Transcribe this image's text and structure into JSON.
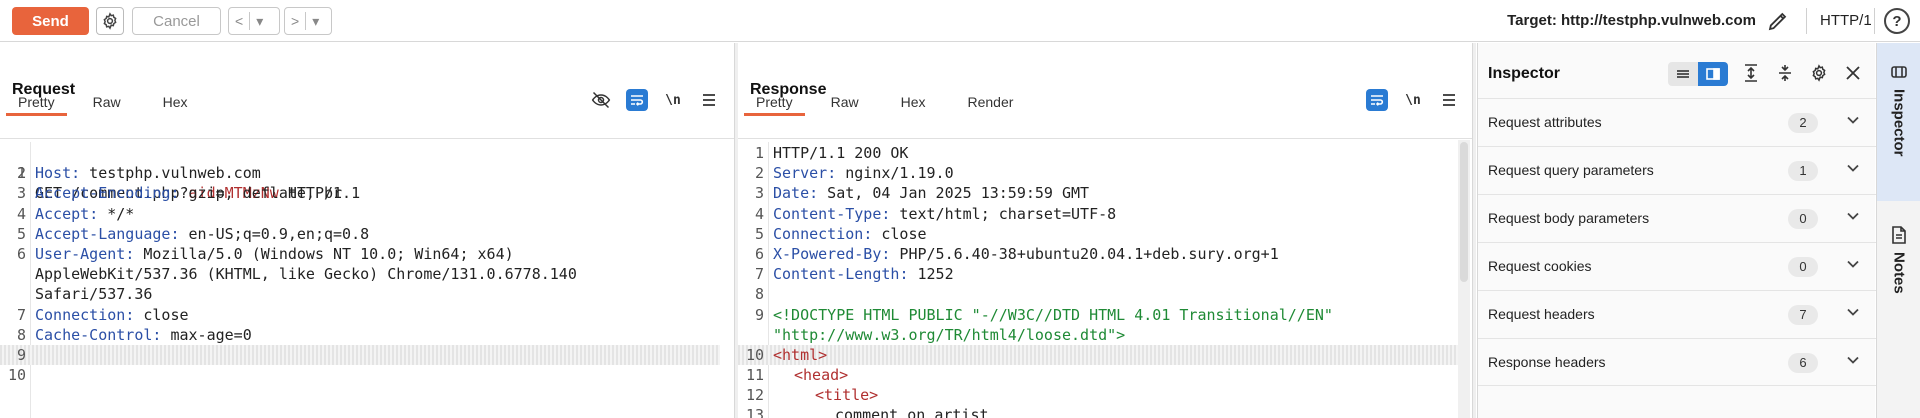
{
  "toolbar": {
    "send_label": "Send",
    "cancel_label": "Cancel",
    "back_label": "<",
    "back_dropdown": "▾",
    "forward_label": ">",
    "forward_dropdown": "▾",
    "target_text": "Target: http://testphp.vulnweb.com",
    "http_version": "HTTP/1",
    "help_label": "?"
  },
  "request": {
    "title": "Request",
    "tabs": [
      "Pretty",
      "Raw",
      "Hex"
    ],
    "active_tab": "Pretty",
    "lines": [
      {
        "n": "1"
      },
      {
        "n": "2",
        "key": "Host",
        "val": " testphp.vulnweb.com"
      },
      {
        "n": "3",
        "key": "Accept-Encoding",
        "val": " gzip, deflate, br"
      },
      {
        "n": "4",
        "key": "Accept",
        "val": " */*"
      },
      {
        "n": "5",
        "key": "Accept-Language",
        "val": " en-US;q=0.9,en;q=0.8"
      },
      {
        "n": "6",
        "key": "User-Agent",
        "val": " Mozilla/5.0 (Windows NT 10.0; Win64; x64)"
      },
      {
        "n": "",
        "val": "AppleWebKit/537.36 (KHTML, like Gecko) Chrome/131.0.6778.140"
      },
      {
        "n": "",
        "val": "Safari/537.36"
      },
      {
        "n": "7",
        "key": "Connection",
        "val": " close"
      },
      {
        "n": "8",
        "key": "Cache-Control",
        "val": " max-age=0"
      },
      {
        "n": "9"
      },
      {
        "n": "10"
      }
    ],
    "line1": {
      "method": "GET /comment.php?",
      "param_key": "aid",
      "eq": "=",
      "param_val": "MTMzNw",
      "proto": " HTTP/1.1"
    }
  },
  "response": {
    "title": "Response",
    "tabs": [
      "Pretty",
      "Raw",
      "Hex",
      "Render"
    ],
    "active_tab": "Pretty",
    "status_line": "HTTP/1.1 200 OK",
    "headers": [
      {
        "n": "2",
        "key": "Server",
        "val": " nginx/1.19.0"
      },
      {
        "n": "3",
        "key": "Date",
        "val": " Sat, 04 Jan 2025 13:59:59 GMT"
      },
      {
        "n": "4",
        "key": "Content-Type",
        "val": " text/html; charset=UTF-8"
      },
      {
        "n": "5",
        "key": "Connection",
        "val": " close"
      },
      {
        "n": "6",
        "key": "X-Powered-By",
        "val": " PHP/5.6.40-38+ubuntu20.04.1+deb.sury.org+1"
      },
      {
        "n": "7",
        "key": "Content-Length",
        "val": " 1252"
      }
    ],
    "doctype_1": "<!DOCTYPE HTML PUBLIC \"-//W3C//DTD HTML 4.01 Transitional//EN\"",
    "doctype_2": "\"http://www.w3.org/TR/html4/loose.dtd\">",
    "html_tag": "<html>",
    "head_tag": "<head>",
    "title_tag": "<title>",
    "title_text": "comment on artist"
  },
  "inspector": {
    "title": "Inspector",
    "rows": [
      {
        "label": "Request attributes",
        "count": "2"
      },
      {
        "label": "Request query parameters",
        "count": "1"
      },
      {
        "label": "Request body parameters",
        "count": "0"
      },
      {
        "label": "Request cookies",
        "count": "0"
      },
      {
        "label": "Request headers",
        "count": "7"
      },
      {
        "label": "Response headers",
        "count": "6"
      }
    ]
  },
  "sidebar": {
    "inspector_label": "Inspector",
    "notes_label": "Notes"
  },
  "colors": {
    "send": "#e8643c",
    "accent_blue": "#2a7bd3",
    "header_key": "#2b4fa6",
    "param": "#b03030",
    "doctype": "#1f8a35"
  }
}
